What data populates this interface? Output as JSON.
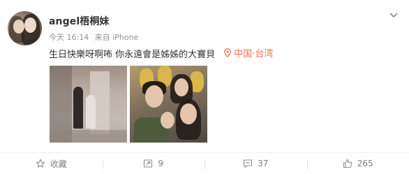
{
  "post": {
    "username": "angel梧桐妹",
    "timestamp": "今天 16:14",
    "source": "来自 iPhone",
    "text": "生日快樂呀啊咘 你永遠會是姊姊的大寶貝",
    "location": "中国·台湾",
    "more_icon": "chevron-down-icon"
  },
  "actions": {
    "favorite_label": "收藏",
    "repost_count": "9",
    "comment_count": "37",
    "like_count": "265"
  },
  "colors": {
    "username": "#333333",
    "meta": "#939393",
    "location": "#eb7350",
    "action_text": "#808080"
  }
}
